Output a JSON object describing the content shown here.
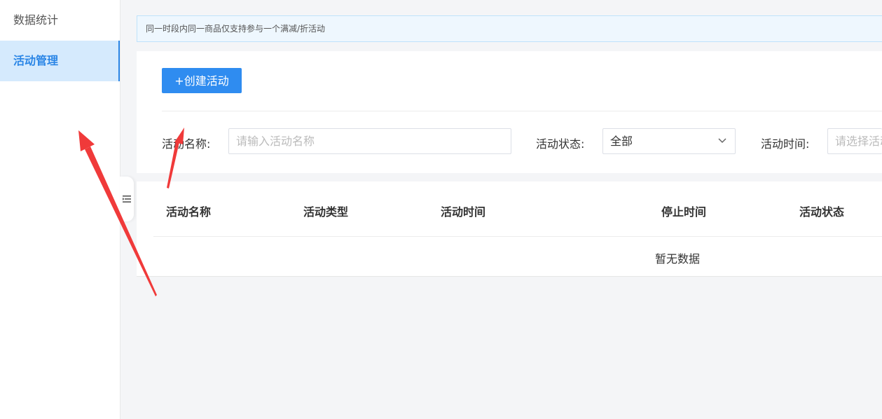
{
  "sidebar": {
    "items": [
      {
        "label": "数据统计",
        "active": false
      },
      {
        "label": "活动管理",
        "active": true
      }
    ],
    "collapse_icon": "menu-fold-icon"
  },
  "notice": {
    "text": "同一时段内同一商品仅支持参与一个满减/折活动"
  },
  "toolbar": {
    "create_label": "+创建活动"
  },
  "filters": {
    "name_label": "活动名称:",
    "name_placeholder": "请输入活动名称",
    "status_label": "活动状态:",
    "status_value": "全部",
    "time_label": "活动时间:",
    "time_placeholder": "请选择活动时间"
  },
  "table": {
    "columns": [
      "活动名称",
      "活动类型",
      "活动时间",
      "停止时间",
      "活动状态"
    ],
    "empty_text": "暂无数据"
  },
  "colors": {
    "primary": "#2f8cf0",
    "active_bg": "#d5eafd",
    "annotation_arrow": "#f03a3a"
  }
}
